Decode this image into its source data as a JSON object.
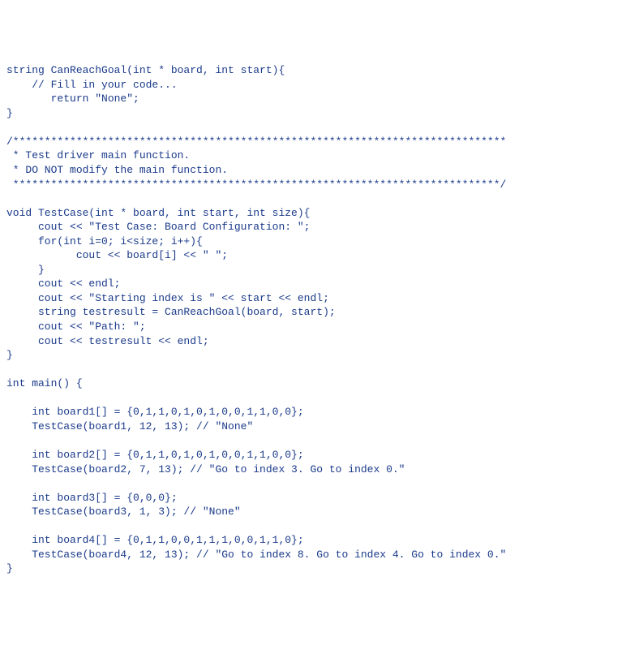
{
  "code": {
    "lines": [
      "string CanReachGoal(int * board, int start){",
      "    // Fill in your code...",
      "       return \"None\";",
      "}",
      "",
      "/******************************************************************************",
      " * Test driver main function.",
      " * DO NOT modify the main function.",
      " *****************************************************************************/",
      "",
      "void TestCase(int * board, int start, int size){",
      "     cout << \"Test Case: Board Configuration: \";",
      "     for(int i=0; i<size; i++){",
      "           cout << board[i] << \" \";",
      "     }",
      "     cout << endl;",
      "     cout << \"Starting index is \" << start << endl;",
      "     string testresult = CanReachGoal(board, start);",
      "     cout << \"Path: \";",
      "     cout << testresult << endl;",
      "}",
      "",
      "int main() {",
      "",
      "    int board1[] = {0,1,1,0,1,0,1,0,0,1,1,0,0};",
      "    TestCase(board1, 12, 13); // \"None\"",
      "",
      "    int board2[] = {0,1,1,0,1,0,1,0,0,1,1,0,0};",
      "    TestCase(board2, 7, 13); // \"Go to index 3. Go to index 0.\"",
      "",
      "    int board3[] = {0,0,0};",
      "    TestCase(board3, 1, 3); // \"None\"",
      "",
      "    int board4[] = {0,1,1,0,0,1,1,1,0,0,1,1,0};",
      "    TestCase(board4, 12, 13); // \"Go to index 8. Go to index 4. Go to index 0.\"",
      "}"
    ]
  }
}
